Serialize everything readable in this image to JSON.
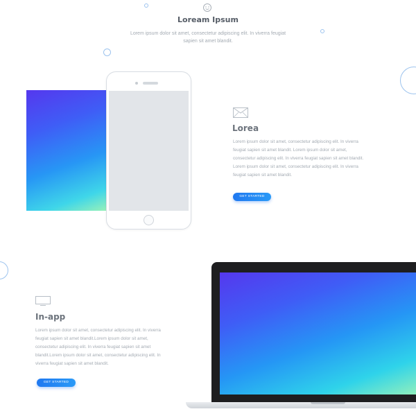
{
  "header": {
    "icon": "smiley-icon",
    "title": "Loream Ipsum",
    "description": "Lorem ipsum dolor sit amet, consectetur adipiscing elit. In viverra feugiat sapien sit amet blandit."
  },
  "feature_one": {
    "icon": "mail-icon",
    "title": "Lorea",
    "body": "Lorem ipsum dolor sit amet, consectetur adipiscing elit. In viverra feugiat sapien sit amet blandit. Lorem ipsum dolor sit amet, consectetur adipiscing elit. In viverra feugiat sapien sit amet blandit. Lorem ipsum dolor sit amet, consectetur adipiscing elit. In viverra feugiat sapien sit amet blandit.",
    "cta_label": "GET STARTED"
  },
  "feature_two": {
    "icon": "tv-icon",
    "title": "In-app",
    "body": "Lorem ipsum dolor sit amet, consectetur adipiscing elit. In viverra feugiat sapien sit amet blandit.Lorem ipsum dolor sit amet, consectetur adipiscing elit. In viverra feugiat sapien sit amet blandit.Lorem ipsum dolor sit amet, consectetur adipiscing elit. In viverra feugiat sapien sit amet blandit.",
    "cta_label": "GET STARTED"
  },
  "colors": {
    "accent": "#1f78f0",
    "gradient_start": "#5538ee",
    "gradient_end": "#9af2b8"
  }
}
